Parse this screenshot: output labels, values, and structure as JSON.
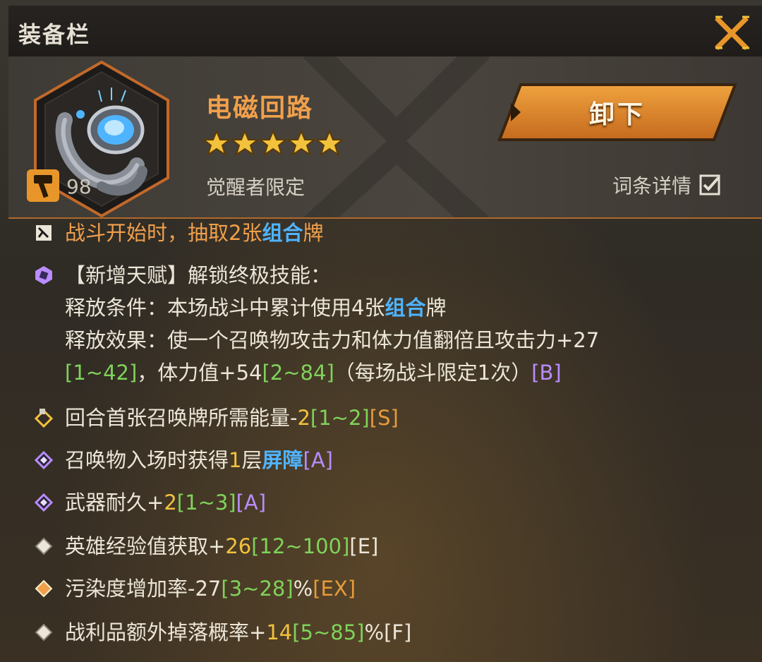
{
  "header": {
    "title": "装备栏"
  },
  "item": {
    "name": "电磁回路",
    "stars": 5,
    "subtitle": "觉醒者限定",
    "level": "98"
  },
  "actions": {
    "unequip_label": "卸下",
    "detail_label": "词条详情",
    "detail_checked": true
  },
  "affixes": [
    {
      "icon": "card-icon",
      "parts": [
        "战斗开始时，抽取2张",
        "组合",
        "牌"
      ]
    },
    {
      "icon": "purple-hex-icon",
      "parts": [
        "【新增天赋】解锁终极技能："
      ]
    },
    {
      "icon": "",
      "parts": [
        "释放条件：本场战斗中累计使用4张",
        "组合",
        "牌"
      ]
    },
    {
      "icon": "",
      "parts": [
        "释放效果：使一个召唤物攻击力和体力值翻倍且攻击力+27"
      ]
    },
    {
      "icon": "",
      "parts": [
        "[1~42]",
        "，体力值+54",
        "[2~84]",
        "（每场战斗限定1次）",
        "[B]"
      ]
    },
    {
      "icon": "lock-diamond-icon",
      "parts": [
        "回合首张召唤牌所需能量-",
        "2",
        "[1~2]",
        "[S]"
      ]
    },
    {
      "icon": "purple-diamond-icon",
      "parts": [
        "召唤物入场时获得",
        "1",
        "层",
        "屏障",
        "[A]"
      ]
    },
    {
      "icon": "purple-diamond-icon",
      "parts": [
        "武器耐久+",
        "2",
        "[1~3]",
        "[A]"
      ]
    },
    {
      "icon": "white-diamond-icon",
      "parts": [
        "英雄经验值获取+",
        "26",
        "[12~100]",
        "[E]"
      ]
    },
    {
      "icon": "orange-diamond-icon",
      "parts": [
        "污染度增加率-27",
        "[3~28]",
        "%",
        "[EX]"
      ]
    },
    {
      "icon": "white-diamond-icon",
      "parts": [
        "战利品额外掉落概率+",
        "14",
        "[5~85]",
        "%",
        "[F]"
      ]
    }
  ],
  "colors": {
    "name": "#f0a04c",
    "keyword": "#4fb4ff",
    "range": "#7fd35a",
    "value": "#f2c23c",
    "rank_a": "#b98cff",
    "rank_s": "#e79b3a"
  }
}
